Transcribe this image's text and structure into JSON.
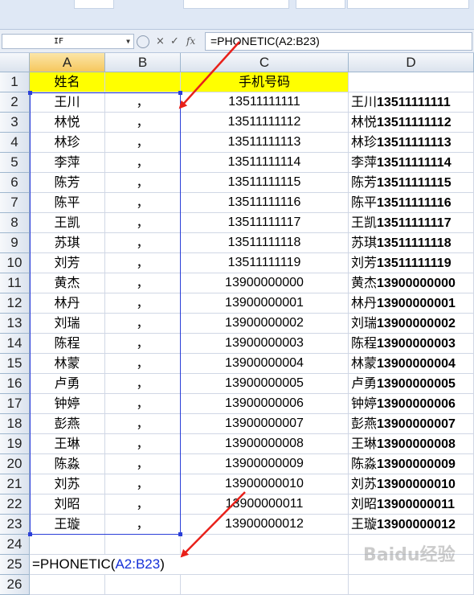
{
  "name_box": {
    "value": "IF"
  },
  "formula_bar": {
    "cancel_icon": "×",
    "enter_icon": "✓",
    "fx_label": "fx",
    "content": "=PHONETIC(A2:B23)"
  },
  "columns": [
    "A",
    "B",
    "C",
    "D"
  ],
  "header_row": {
    "row": "1",
    "a": "姓名",
    "b": "",
    "c": "手机号码",
    "d": ""
  },
  "rows": [
    {
      "row": "2",
      "name": "王川",
      "sep": "，",
      "phone": "13511111111",
      "combined_name": "王川",
      "combined_phone": "13511111111"
    },
    {
      "row": "3",
      "name": "林悦",
      "sep": "，",
      "phone": "13511111112",
      "combined_name": "林悦",
      "combined_phone": "13511111112"
    },
    {
      "row": "4",
      "name": "林珍",
      "sep": "，",
      "phone": "13511111113",
      "combined_name": "林珍",
      "combined_phone": "13511111113"
    },
    {
      "row": "5",
      "name": "李萍",
      "sep": "，",
      "phone": "13511111114",
      "combined_name": "李萍",
      "combined_phone": "13511111114"
    },
    {
      "row": "6",
      "name": "陈芳",
      "sep": "，",
      "phone": "13511111115",
      "combined_name": "陈芳",
      "combined_phone": "13511111115"
    },
    {
      "row": "7",
      "name": "陈平",
      "sep": "，",
      "phone": "13511111116",
      "combined_name": "陈平",
      "combined_phone": "13511111116"
    },
    {
      "row": "8",
      "name": "王凯",
      "sep": "，",
      "phone": "13511111117",
      "combined_name": "王凯",
      "combined_phone": "13511111117"
    },
    {
      "row": "9",
      "name": "苏琪",
      "sep": "，",
      "phone": "13511111118",
      "combined_name": "苏琪",
      "combined_phone": "13511111118"
    },
    {
      "row": "10",
      "name": "刘芳",
      "sep": "，",
      "phone": "13511111119",
      "combined_name": "刘芳",
      "combined_phone": "13511111119"
    },
    {
      "row": "11",
      "name": "黄杰",
      "sep": "，",
      "phone": "13900000000",
      "combined_name": "黄杰",
      "combined_phone": "13900000000"
    },
    {
      "row": "12",
      "name": "林丹",
      "sep": "，",
      "phone": "13900000001",
      "combined_name": "林丹",
      "combined_phone": "13900000001"
    },
    {
      "row": "13",
      "name": "刘瑞",
      "sep": "，",
      "phone": "13900000002",
      "combined_name": "刘瑞",
      "combined_phone": "13900000002"
    },
    {
      "row": "14",
      "name": "陈程",
      "sep": "，",
      "phone": "13900000003",
      "combined_name": "陈程",
      "combined_phone": "13900000003"
    },
    {
      "row": "15",
      "name": "林蒙",
      "sep": "，",
      "phone": "13900000004",
      "combined_name": "林蒙",
      "combined_phone": "13900000004"
    },
    {
      "row": "16",
      "name": "卢勇",
      "sep": "，",
      "phone": "13900000005",
      "combined_name": "卢勇",
      "combined_phone": "13900000005"
    },
    {
      "row": "17",
      "name": "钟婷",
      "sep": "，",
      "phone": "13900000006",
      "combined_name": "钟婷",
      "combined_phone": "13900000006"
    },
    {
      "row": "18",
      "name": "彭燕",
      "sep": "，",
      "phone": "13900000007",
      "combined_name": "彭燕",
      "combined_phone": "13900000007"
    },
    {
      "row": "19",
      "name": "王琳",
      "sep": "，",
      "phone": "13900000008",
      "combined_name": "王琳",
      "combined_phone": "13900000008"
    },
    {
      "row": "20",
      "name": "陈淼",
      "sep": "，",
      "phone": "13900000009",
      "combined_name": "陈淼",
      "combined_phone": "13900000009"
    },
    {
      "row": "21",
      "name": "刘苏",
      "sep": "，",
      "phone": "13900000010",
      "combined_name": "刘苏",
      "combined_phone": "13900000010"
    },
    {
      "row": "22",
      "name": "刘昭",
      "sep": "，",
      "phone": "13900000011",
      "combined_name": "刘昭",
      "combined_phone": "13900000011"
    },
    {
      "row": "23",
      "name": "王璇",
      "sep": "，",
      "phone": "13900000012",
      "combined_name": "王璇",
      "combined_phone": "13900000012"
    }
  ],
  "empty_rows": [
    "24",
    "26"
  ],
  "edit_row": {
    "row": "25",
    "func": "=PHONETIC(",
    "ref": "A2:B23",
    "close": ")"
  },
  "watermark": {
    "text": "Baidu经验"
  },
  "colors": {
    "header_fill": "#ffff00",
    "selection_border": "#2b3fd8",
    "arrow": "#e8201a",
    "ref_text": "#1530d8"
  }
}
